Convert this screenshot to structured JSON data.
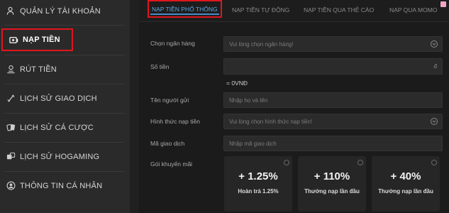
{
  "sidebar": {
    "items": [
      {
        "label": "QUẢN LÝ TÀI KHOẢN",
        "icon": "user-settings-icon"
      },
      {
        "label": "NẠP TIỀN",
        "icon": "deposit-icon",
        "active": true
      },
      {
        "label": "RÚT TIỀN",
        "icon": "withdraw-icon"
      },
      {
        "label": "LỊCH SỬ GIAO DỊCH",
        "icon": "transaction-history-icon"
      },
      {
        "label": "LỊCH SỬ CÁ CƯỢC",
        "icon": "cards-icon"
      },
      {
        "label": "LỊCH SỬ HOGAMING",
        "icon": "dice-icon"
      },
      {
        "label": "THÔNG TIN CÁ NHÂN",
        "icon": "profile-icon"
      }
    ]
  },
  "tabs": [
    {
      "label": "NẠP TIỀN PHỔ THÔNG",
      "active": true
    },
    {
      "label": "NẠP TIỀN TỰ ĐỘNG"
    },
    {
      "label": "NẠP TIỀN QUA THẺ CÀO"
    },
    {
      "label": "NẠP QUA MOMO"
    }
  ],
  "form": {
    "bank": {
      "label": "Chọn ngân hàng",
      "placeholder": "Vui lòng chọn ngân hàng!"
    },
    "amount": {
      "label": "Số tiền",
      "unit": "đ",
      "converted": "= 0VNĐ"
    },
    "sender": {
      "label": "Tên người gửi",
      "placeholder": "Nhập họ và tên"
    },
    "method": {
      "label": "Hình thức nạp tiền",
      "placeholder": "Vui lòng chọn hình thức nạp tiền!"
    },
    "txcode": {
      "label": "Mã giao dịch",
      "placeholder": "Nhập mã giao dịch"
    },
    "promo_label": "Gói khuyến mãi"
  },
  "promos": [
    {
      "value": "+ 1.25%",
      "desc": "Hoàn trả 1.25%"
    },
    {
      "value": "+ 110%",
      "desc": "Thưởng nạp lần đầu"
    },
    {
      "value": "+ 40%",
      "desc": "Thưởng nạp lần đầu"
    }
  ],
  "colors": {
    "active_border": "#e0161c",
    "active_tab_text": "#5aa9e6"
  }
}
